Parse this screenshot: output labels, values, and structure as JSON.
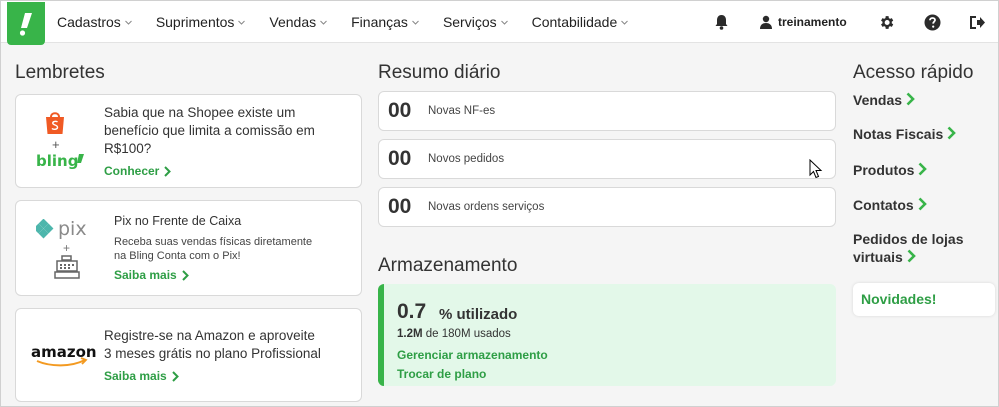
{
  "nav": {
    "logo_glyph": "!",
    "menu": [
      "Cadastros",
      "Suprimentos",
      "Vendas",
      "Finanças",
      "Serviços",
      "Contabilidade"
    ],
    "user": "treinamento"
  },
  "reminders": {
    "title": "Lembretes",
    "cards": [
      {
        "title_lines": [
          "Sabia que na Shopee existe um",
          "benefício que limita a comissão em",
          "R$100?"
        ],
        "link": "Conhecer",
        "brand_top": "shopee",
        "brand_bottom": "bling",
        "plus": "+"
      },
      {
        "title": "Pix no Frente de Caixa",
        "desc_lines": [
          "Receba suas vendas físicas diretamente",
          "na Bling Conta com o Pix!"
        ],
        "link": "Saiba mais",
        "brand_top": "pix",
        "plus": "+"
      },
      {
        "title_lines": [
          "Registre-se na Amazon e aproveite",
          "3 meses grátis no plano Profissional"
        ],
        "link": "Saiba mais",
        "brand": "amazon"
      }
    ]
  },
  "summary": {
    "title": "Resumo diário",
    "items": [
      {
        "count": "00",
        "label": "Novas NF-es"
      },
      {
        "count": "00",
        "label": "Novos pedidos"
      },
      {
        "count": "00",
        "label": "Novas ordens serviços"
      }
    ]
  },
  "storage": {
    "title": "Armazenamento",
    "value": "0.7",
    "unit": "% utilizado",
    "used_amount": "1.2M",
    "used_rest": " de 180M usados",
    "links": [
      "Gerenciar armazenamento",
      "Trocar de plano"
    ]
  },
  "quick_access": {
    "title": "Acesso rápido",
    "items": [
      "Vendas",
      "Notas Fiscais",
      "Produtos",
      "Contatos"
    ],
    "multiline_item": [
      "Pedidos de lojas",
      "virtuais"
    ],
    "news": "Novidades!"
  },
  "colors": {
    "accent": "#38b449",
    "link": "#2e9e45",
    "storage_bg": "#e3f8e9"
  }
}
